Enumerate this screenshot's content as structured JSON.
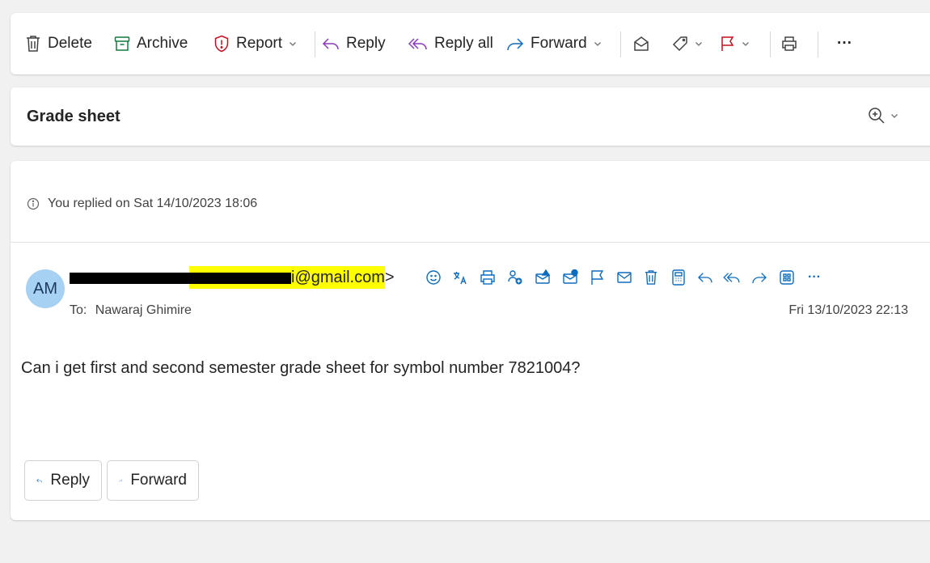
{
  "toolbar": {
    "delete": "Delete",
    "archive": "Archive",
    "report": "Report",
    "reply": "Reply",
    "reply_all": "Reply all",
    "forward": "Forward",
    "more": "···"
  },
  "subject": {
    "title": "Grade sheet"
  },
  "message": {
    "replied_notice": "You replied on Sat 14/10/2023 18:06",
    "avatar_initials": "AM",
    "sender_email_visible": "i@gmail.com",
    "sender_suffix": ">",
    "to_label": "To:",
    "to_name": "Nawaraj Ghimire",
    "date": "Fri 13/10/2023 22:13",
    "body": "Can i get first and second semester grade sheet for symbol number 7821004?",
    "more": "···"
  },
  "quick_actions": {
    "reply": "Reply",
    "forward": "Forward"
  },
  "colors": {
    "background": "#f1f1f1",
    "card": "#ffffff",
    "archive_icon": "#0f7b3f",
    "report_icon": "#c50f1f",
    "reply_icon": "#8a3ab9",
    "forward_icon": "#0f6cbd",
    "flag_icon": "#c50f1f",
    "avatar": "#a7d1f3",
    "highlight": "#ffff00"
  }
}
